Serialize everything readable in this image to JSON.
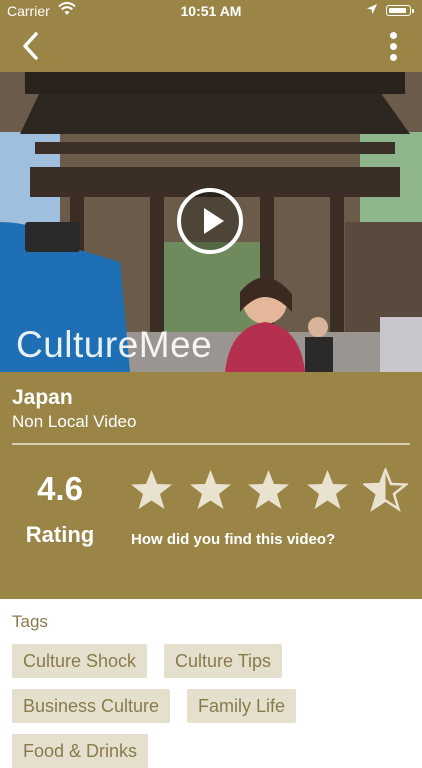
{
  "status_bar": {
    "carrier": "Carrier",
    "time": "10:51 AM",
    "battery_level": 0.92
  },
  "nav": {
    "back_icon": "chevron-left-icon",
    "more_icon": "more-vertical-icon"
  },
  "video": {
    "watermark": "CultureMee",
    "play_icon": "play-icon"
  },
  "info": {
    "country": "Japan",
    "subtitle": "Non Local Video",
    "rating_value": "4.6",
    "rating_label": "Rating",
    "stars_filled": 4.5,
    "stars_total": 5,
    "prompt": "How did you find this video?"
  },
  "tags": {
    "heading": "Tags",
    "items": [
      "Culture Shock",
      "Culture Tips",
      "Business Culture",
      "Family Life",
      "Food & Drinks"
    ]
  },
  "colors": {
    "brand": "#9a8547",
    "tag_bg": "#e5e0cd",
    "tag_text": "#8a7a4e",
    "star": "#e9e2cf"
  }
}
